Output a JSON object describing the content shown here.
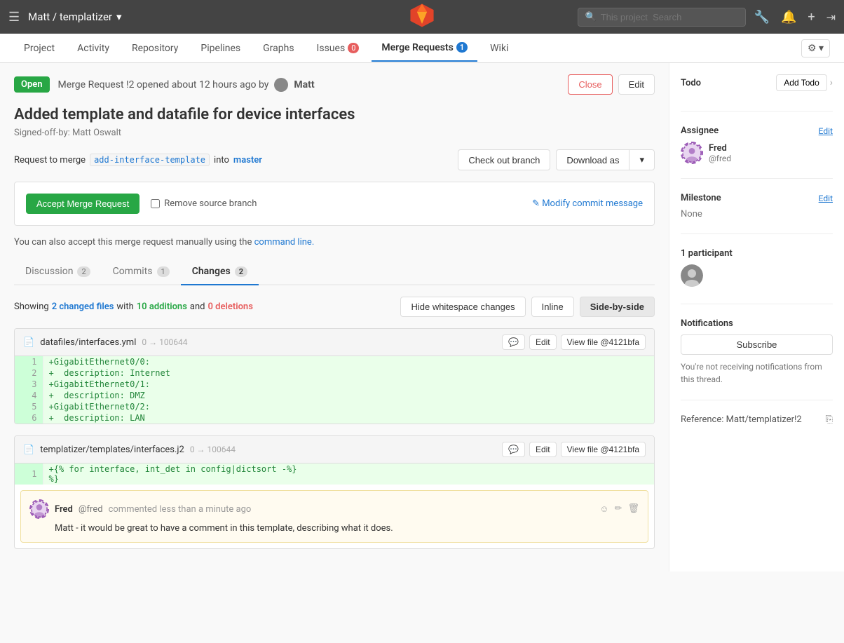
{
  "topNav": {
    "hamburger": "☰",
    "brand": "Matt / templatizer",
    "brandChevron": "▾",
    "search": {
      "placeholder": "This project  Search"
    },
    "icons": [
      "🔧",
      "🔔",
      "+",
      "→"
    ]
  },
  "secondNav": {
    "items": [
      {
        "label": "Project",
        "active": false,
        "badge": null
      },
      {
        "label": "Activity",
        "active": false,
        "badge": null
      },
      {
        "label": "Repository",
        "active": false,
        "badge": null
      },
      {
        "label": "Pipelines",
        "active": false,
        "badge": null
      },
      {
        "label": "Graphs",
        "active": false,
        "badge": null
      },
      {
        "label": "Issues",
        "active": false,
        "badge": "0"
      },
      {
        "label": "Merge Requests",
        "active": true,
        "badge": "1"
      },
      {
        "label": "Wiki",
        "active": false,
        "badge": null
      }
    ],
    "settings_label": "⚙ ▾"
  },
  "mergeRequest": {
    "status": "Open",
    "headerText": "Merge Request !2 opened about 12 hours ago by",
    "author": "Matt",
    "closeLabel": "Close",
    "editLabel": "Edit",
    "title": "Added template and datafile for device interfaces",
    "subtitle": "Signed-off-by: Matt Oswalt",
    "mergeInfo": {
      "prefix": "Request to merge",
      "sourceBranch": "add-interface-template",
      "into": "into",
      "targetBranch": "master"
    },
    "checkoutLabel": "Check out branch",
    "downloadLabel": "Download as",
    "acceptLabel": "Accept Merge Request",
    "removeSourceLabel": "Remove source branch",
    "modifyCommitLabel": "✎ Modify commit message",
    "cmdLineText": "You can also accept this merge request manually using the",
    "cmdLineLink": "command line.",
    "tabs": [
      {
        "label": "Discussion",
        "count": "2"
      },
      {
        "label": "Commits",
        "count": "1"
      },
      {
        "label": "Changes",
        "count": "2",
        "active": true
      }
    ],
    "diffStats": {
      "prefix": "Showing",
      "changedFiles": "2 changed files",
      "middle": "with",
      "additions": "10 additions",
      "and": "and",
      "deletions": "0 deletions"
    },
    "diffButtons": [
      {
        "label": "Hide whitespace changes"
      },
      {
        "label": "Inline"
      },
      {
        "label": "Side-by-side",
        "active": true
      }
    ],
    "files": [
      {
        "name": "datafiles/interfaces.yml",
        "revision": "0 → 100644",
        "lines": [
          {
            "num": "1",
            "content": "+GigabitEthernet0/0:",
            "type": "added"
          },
          {
            "num": "2",
            "content": "+  description: Internet",
            "type": "added"
          },
          {
            "num": "3",
            "content": "+GigabitEthernet0/1:",
            "type": "added"
          },
          {
            "num": "4",
            "content": "+  description: DMZ",
            "type": "added"
          },
          {
            "num": "5",
            "content": "+GigabitEthernet0/2:",
            "type": "added"
          },
          {
            "num": "6",
            "content": "+  description: LAN",
            "type": "added"
          }
        ]
      },
      {
        "name": "templatizer/templates/interfaces.j2",
        "revision": "0 → 100644",
        "lines": [
          {
            "num": "1",
            "content": "+{% for interface, int_det in config|dictsort -%}",
            "type": "added-long"
          }
        ],
        "comment": {
          "avatar": "👤",
          "author": "Fred",
          "handle": "@fred",
          "time": "commented less than a minute ago",
          "body": "Matt - it would be great to have a comment in this template, describing what it does."
        }
      }
    ]
  },
  "sidebar": {
    "todo": {
      "title": "Todo",
      "addLabel": "Add Todo",
      "expandIcon": "›"
    },
    "assignee": {
      "label": "Assignee",
      "editLabel": "Edit",
      "name": "Fred",
      "handle": "@fred",
      "avatar": "👤"
    },
    "milestone": {
      "label": "Milestone",
      "editLabel": "Edit",
      "value": "None"
    },
    "participants": {
      "label": "1 participant"
    },
    "notifications": {
      "label": "Notifications",
      "subscribeLabel": "Subscribe",
      "text": "You're not receiving notifications from this thread."
    },
    "reference": {
      "label": "Reference: Matt/templatizer!2",
      "copyIcon": "⎘"
    }
  }
}
